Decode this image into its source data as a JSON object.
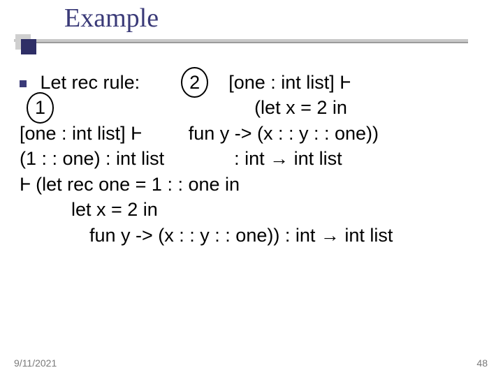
{
  "title": "Example",
  "footer": {
    "date": "9/11/2021",
    "page": "48"
  },
  "line1": {
    "label": "Let rec rule:",
    "circled": "2",
    "after": "[one : int list] Ⱶ"
  },
  "line2": {
    "circled": "1",
    "right": "(let x = 2 in"
  },
  "line3": {
    "left": "[one : int list] Ⱶ",
    "right": "fun y -> (x : : y : : one))"
  },
  "line4": {
    "left": "(1 : : one) : int list",
    "right": ": int → int list"
  },
  "line5": "Ⱶ (let rec one = 1 : : one in",
  "line6": "let x = 2 in",
  "line7": "fun y -> (x : : y : : one)) : int → int list"
}
